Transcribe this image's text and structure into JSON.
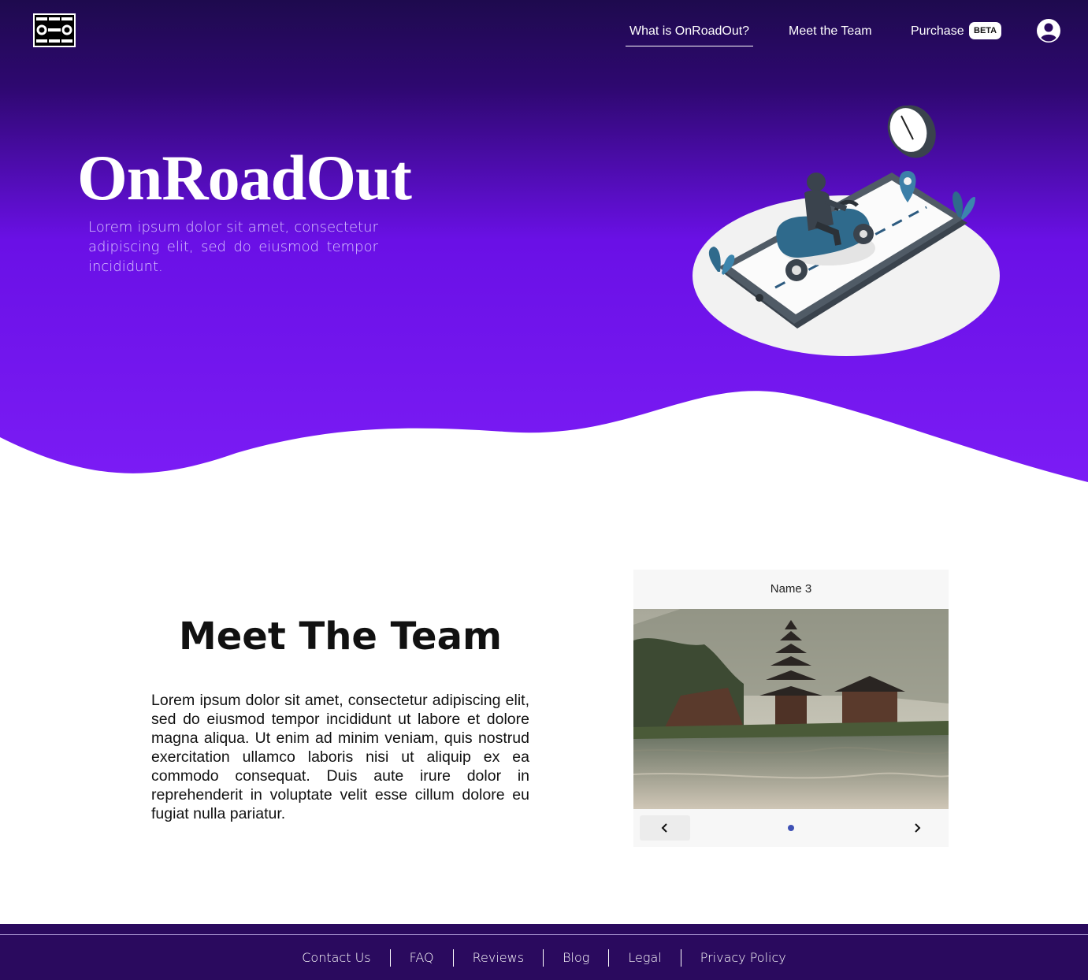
{
  "header": {
    "logo_icon": "road-logo-icon",
    "nav": [
      {
        "label": "What is OnRoadOut?",
        "active": true
      },
      {
        "label": "Meet the Team",
        "active": false
      },
      {
        "label": "Purchase",
        "active": false
      }
    ],
    "beta_badge": "BETA",
    "account_icon": "account-circle-icon"
  },
  "hero": {
    "title": "OnRoadOut",
    "subtitle": "Lorem ipsum dolor sit amet, consectetur adipiscing elit, sed do eiusmod tempor incididunt.",
    "illustration": "scooter-on-phone-illustration",
    "gradient_colors": [
      "#1e0a4e",
      "#6a10e6",
      "#7a1cf4"
    ]
  },
  "team": {
    "title": "Meet The Team",
    "text": "Lorem ipsum dolor sit amet, consectetur adipiscing elit, sed do eiusmod tempor incididunt ut labore et dolore magna aliqua. Ut enim ad minim veniam, quis nostrud exercitation ullamco laboris nisi ut aliquip ex ea commodo consequat. Duis aute irure dolor in reprehenderit in voluptate velit esse cillum dolore eu fugiat nulla pariatur.",
    "carousel": {
      "name": "Name 3",
      "image": "temple-lake-photo",
      "prev_icon": "chevron-left-icon",
      "next_icon": "chevron-right-icon",
      "dot_color": "#3f51b5"
    }
  },
  "footer": {
    "links": [
      "Contact Us",
      "FAQ",
      "Reviews",
      "Blog",
      "Legal",
      "Privacy Policy"
    ]
  }
}
